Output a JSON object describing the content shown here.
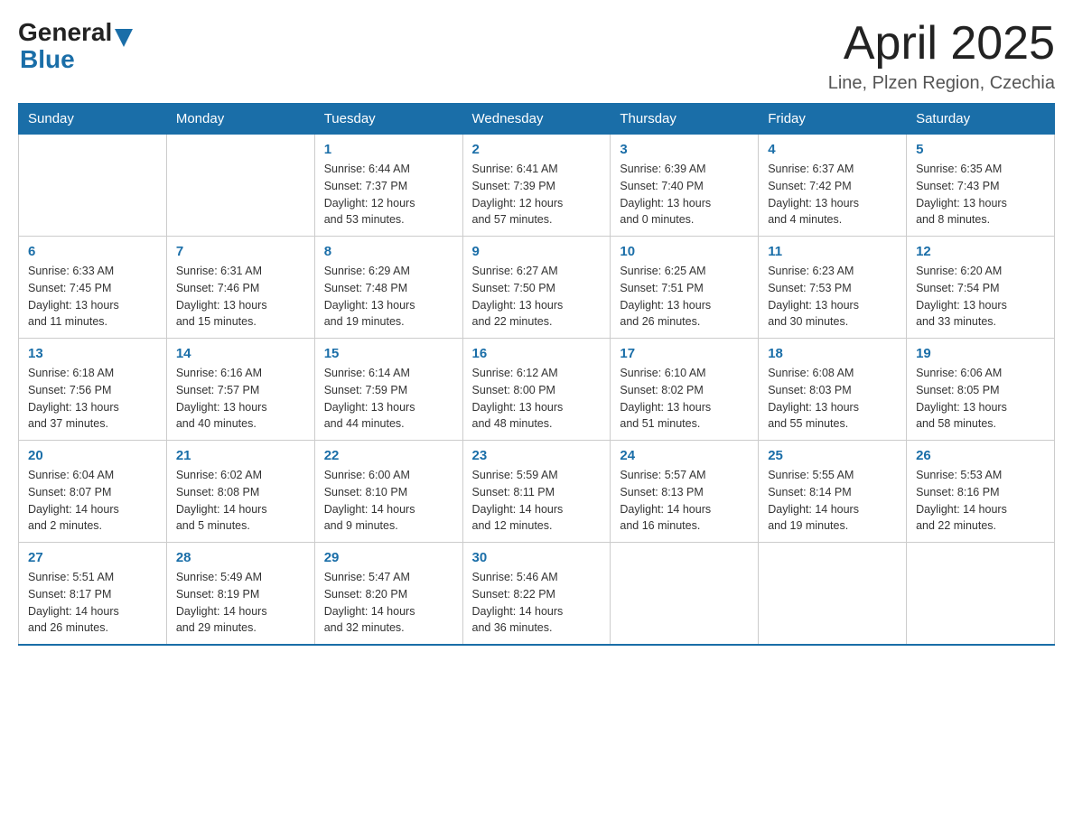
{
  "header": {
    "logo_general": "General",
    "logo_blue": "Blue",
    "month_title": "April 2025",
    "subtitle": "Line, Plzen Region, Czechia"
  },
  "weekdays": [
    "Sunday",
    "Monday",
    "Tuesday",
    "Wednesday",
    "Thursday",
    "Friday",
    "Saturday"
  ],
  "weeks": [
    [
      {
        "day": "",
        "info": ""
      },
      {
        "day": "",
        "info": ""
      },
      {
        "day": "1",
        "info": "Sunrise: 6:44 AM\nSunset: 7:37 PM\nDaylight: 12 hours\nand 53 minutes."
      },
      {
        "day": "2",
        "info": "Sunrise: 6:41 AM\nSunset: 7:39 PM\nDaylight: 12 hours\nand 57 minutes."
      },
      {
        "day": "3",
        "info": "Sunrise: 6:39 AM\nSunset: 7:40 PM\nDaylight: 13 hours\nand 0 minutes."
      },
      {
        "day": "4",
        "info": "Sunrise: 6:37 AM\nSunset: 7:42 PM\nDaylight: 13 hours\nand 4 minutes."
      },
      {
        "day": "5",
        "info": "Sunrise: 6:35 AM\nSunset: 7:43 PM\nDaylight: 13 hours\nand 8 minutes."
      }
    ],
    [
      {
        "day": "6",
        "info": "Sunrise: 6:33 AM\nSunset: 7:45 PM\nDaylight: 13 hours\nand 11 minutes."
      },
      {
        "day": "7",
        "info": "Sunrise: 6:31 AM\nSunset: 7:46 PM\nDaylight: 13 hours\nand 15 minutes."
      },
      {
        "day": "8",
        "info": "Sunrise: 6:29 AM\nSunset: 7:48 PM\nDaylight: 13 hours\nand 19 minutes."
      },
      {
        "day": "9",
        "info": "Sunrise: 6:27 AM\nSunset: 7:50 PM\nDaylight: 13 hours\nand 22 minutes."
      },
      {
        "day": "10",
        "info": "Sunrise: 6:25 AM\nSunset: 7:51 PM\nDaylight: 13 hours\nand 26 minutes."
      },
      {
        "day": "11",
        "info": "Sunrise: 6:23 AM\nSunset: 7:53 PM\nDaylight: 13 hours\nand 30 minutes."
      },
      {
        "day": "12",
        "info": "Sunrise: 6:20 AM\nSunset: 7:54 PM\nDaylight: 13 hours\nand 33 minutes."
      }
    ],
    [
      {
        "day": "13",
        "info": "Sunrise: 6:18 AM\nSunset: 7:56 PM\nDaylight: 13 hours\nand 37 minutes."
      },
      {
        "day": "14",
        "info": "Sunrise: 6:16 AM\nSunset: 7:57 PM\nDaylight: 13 hours\nand 40 minutes."
      },
      {
        "day": "15",
        "info": "Sunrise: 6:14 AM\nSunset: 7:59 PM\nDaylight: 13 hours\nand 44 minutes."
      },
      {
        "day": "16",
        "info": "Sunrise: 6:12 AM\nSunset: 8:00 PM\nDaylight: 13 hours\nand 48 minutes."
      },
      {
        "day": "17",
        "info": "Sunrise: 6:10 AM\nSunset: 8:02 PM\nDaylight: 13 hours\nand 51 minutes."
      },
      {
        "day": "18",
        "info": "Sunrise: 6:08 AM\nSunset: 8:03 PM\nDaylight: 13 hours\nand 55 minutes."
      },
      {
        "day": "19",
        "info": "Sunrise: 6:06 AM\nSunset: 8:05 PM\nDaylight: 13 hours\nand 58 minutes."
      }
    ],
    [
      {
        "day": "20",
        "info": "Sunrise: 6:04 AM\nSunset: 8:07 PM\nDaylight: 14 hours\nand 2 minutes."
      },
      {
        "day": "21",
        "info": "Sunrise: 6:02 AM\nSunset: 8:08 PM\nDaylight: 14 hours\nand 5 minutes."
      },
      {
        "day": "22",
        "info": "Sunrise: 6:00 AM\nSunset: 8:10 PM\nDaylight: 14 hours\nand 9 minutes."
      },
      {
        "day": "23",
        "info": "Sunrise: 5:59 AM\nSunset: 8:11 PM\nDaylight: 14 hours\nand 12 minutes."
      },
      {
        "day": "24",
        "info": "Sunrise: 5:57 AM\nSunset: 8:13 PM\nDaylight: 14 hours\nand 16 minutes."
      },
      {
        "day": "25",
        "info": "Sunrise: 5:55 AM\nSunset: 8:14 PM\nDaylight: 14 hours\nand 19 minutes."
      },
      {
        "day": "26",
        "info": "Sunrise: 5:53 AM\nSunset: 8:16 PM\nDaylight: 14 hours\nand 22 minutes."
      }
    ],
    [
      {
        "day": "27",
        "info": "Sunrise: 5:51 AM\nSunset: 8:17 PM\nDaylight: 14 hours\nand 26 minutes."
      },
      {
        "day": "28",
        "info": "Sunrise: 5:49 AM\nSunset: 8:19 PM\nDaylight: 14 hours\nand 29 minutes."
      },
      {
        "day": "29",
        "info": "Sunrise: 5:47 AM\nSunset: 8:20 PM\nDaylight: 14 hours\nand 32 minutes."
      },
      {
        "day": "30",
        "info": "Sunrise: 5:46 AM\nSunset: 8:22 PM\nDaylight: 14 hours\nand 36 minutes."
      },
      {
        "day": "",
        "info": ""
      },
      {
        "day": "",
        "info": ""
      },
      {
        "day": "",
        "info": ""
      }
    ]
  ]
}
